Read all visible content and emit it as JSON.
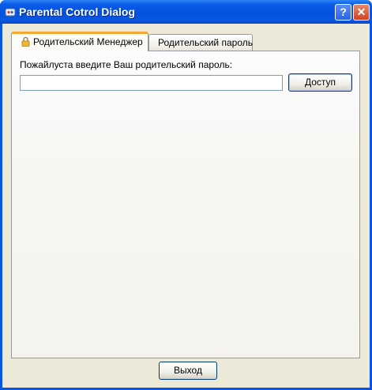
{
  "window": {
    "title": "Parental Cotrol Dialog",
    "help_glyph": "?",
    "close_glyph": "✕"
  },
  "tabs": [
    {
      "label": "Родительский Менеджер",
      "active": true
    },
    {
      "label": "Родительский пароль",
      "active": false
    }
  ],
  "panel": {
    "prompt": "Пожайлуста введите Ваш родительский пароль:",
    "password_value": "",
    "access_label": "Доступ"
  },
  "footer": {
    "exit_label": "Выход"
  },
  "colors": {
    "titlebar": "#0a54e3",
    "active_tab_accent": "#f5a730",
    "client_bg": "#ece9d8"
  },
  "icons": {
    "app": "parental-control-icon",
    "tab": "lock-icon"
  }
}
